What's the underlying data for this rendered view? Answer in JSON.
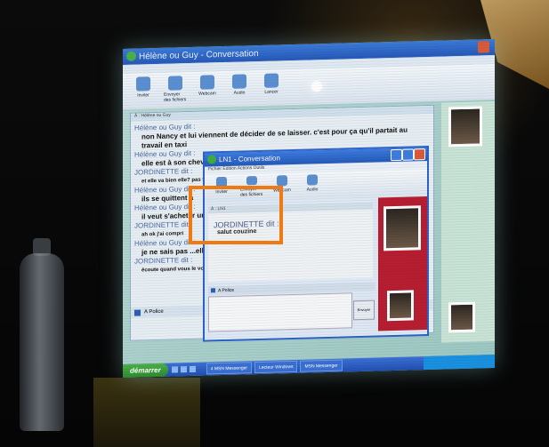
{
  "main_window": {
    "title": "Hélène ou Guy - Conversation",
    "to_line": "À : Hélène ou Guy",
    "toolbar": [
      "Inviter",
      "Envoyer des fichiers",
      "Webcam",
      "Audio",
      "Lancer"
    ],
    "history": [
      {
        "who": "Hélène ou Guy dit :",
        "msg": "non Nancy et lui viennent de décider de se laisser. c'est pour ça qu'il partait au travail en taxi"
      },
      {
        "who": "Hélène ou Guy dit :",
        "msg": "elle est à son cheval"
      },
      {
        "who": "JORDINETTE dit :",
        "msg": "et elle va bien elle? pas t"
      },
      {
        "who": "Hélène ou Guy dit :",
        "msg": "ils se quittent à"
      },
      {
        "who": "Hélène ou Guy dit :",
        "msg": "il veut s'acheter une"
      },
      {
        "who": "JORDINETTE dit :",
        "msg": "ah ok j'ai compri"
      },
      {
        "who": "Hélène ou Guy dit :",
        "msg": "je ne sais pas ...elles qui vient.)"
      },
      {
        "who": "JORDINETTE dit :",
        "msg": "écoute quand vous le voy zée!!"
      }
    ],
    "input_label": "A Police"
  },
  "inner_window": {
    "title": "LN1 - Conversation",
    "menu": "Fichier  Édition  Actions  Outils",
    "to_line": "À : LN1",
    "who": "JORDINETTE dit :",
    "msg": "salut couzine",
    "format_label": "A Police",
    "send_label": "Envoyer"
  },
  "taskbar": {
    "start": "démarrer",
    "tasks": [
      "4 MSN Messenger",
      "Lecteur Windows",
      "MSN Messenger"
    ]
  },
  "colors": {
    "highlight": "#f07a12",
    "titlebar": "#2658b8",
    "start_button": "#2d8a2d"
  }
}
